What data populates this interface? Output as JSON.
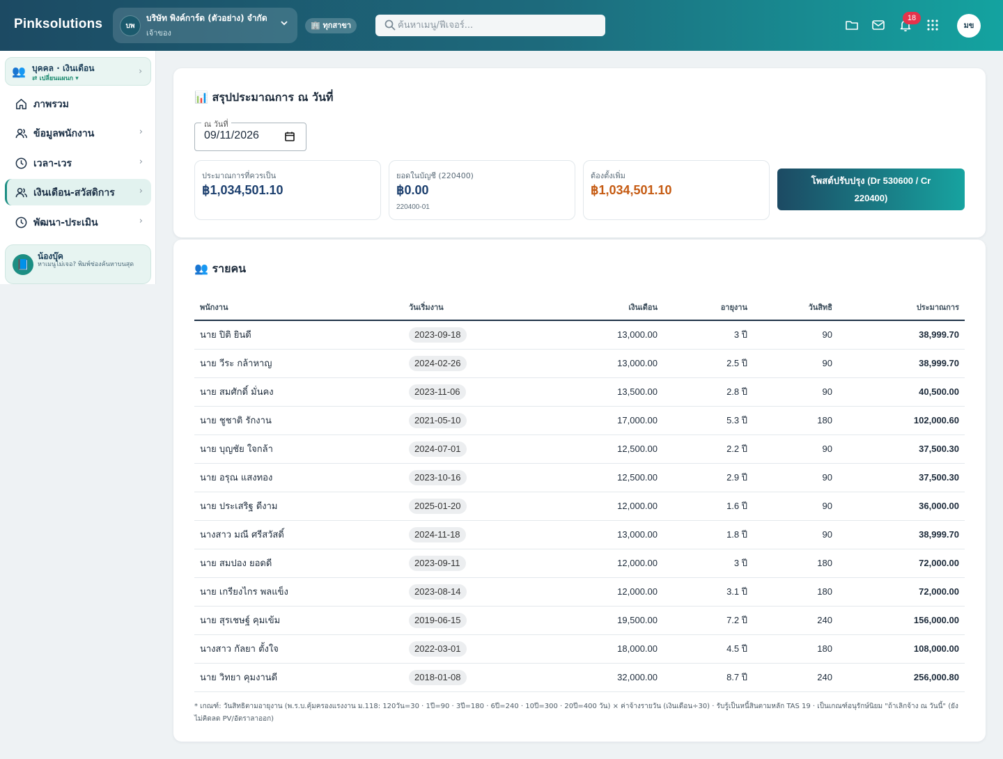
{
  "app": {
    "brand": "Pinksolutions"
  },
  "company": {
    "initials": "บพ",
    "name": "บริษัท พิงค์การ์ด (ตัวอย่าง) จำกัด",
    "role": "เจ้าของ"
  },
  "branch": {
    "label": "🏢 ทุกสาขา"
  },
  "search": {
    "placeholder": "ค้นหาเมนู/ฟีเจอร์..."
  },
  "notifications": {
    "count": "18"
  },
  "user": {
    "initials": "มข"
  },
  "sidebar": {
    "module": {
      "title": "บุคคล · เงินเดือน",
      "sub": "⇄ เปลี่ยนแผนก ▾"
    },
    "items": [
      {
        "label": "ภาพรวม"
      },
      {
        "label": "ข้อมูลพนักงาน"
      },
      {
        "label": "เวลา-เวร"
      },
      {
        "label": "เงินเดือน-สวัสดิการ"
      },
      {
        "label": "พัฒนา-ประเมิน"
      }
    ],
    "helper": {
      "name": "น้องบุ๊ค",
      "text": "หาเมนูไม่เจอ? พิมพ์ช่องค้นหาบนสุด"
    }
  },
  "summary": {
    "title": "📊 สรุปประมาณการ ณ วันที่",
    "date_label": "ณ วันที่",
    "date_value": "09/11/2026",
    "stats": [
      {
        "label": "ประมาณการที่ควรเป็น",
        "value": "฿1,034,501.10",
        "sub": ""
      },
      {
        "label": "ยอดในบัญชี (220400)",
        "value": "฿0.00",
        "sub": "220400-01"
      },
      {
        "label": "ต้องตั้งเพิ่ม",
        "value": "฿1,034,501.10",
        "sub": ""
      }
    ],
    "post_button": "โพสต์ปรับปรุง (Dr 530600 / Cr 220400)"
  },
  "employees": {
    "title": "👥 รายคน",
    "columns": [
      "พนักงาน",
      "วันเริ่มงาน",
      "เงินเดือน",
      "อายุงาน",
      "วันสิทธิ",
      "ประมาณการ"
    ],
    "rows": [
      [
        "นาย ปิติ ยินดี",
        "2023-09-18",
        "13,000.00",
        "3 ปี",
        "90",
        "38,999.70"
      ],
      [
        "นาย วีระ กล้าหาญ",
        "2024-02-26",
        "13,000.00",
        "2.5 ปี",
        "90",
        "38,999.70"
      ],
      [
        "นาย สมศักดิ์ มั่นคง",
        "2023-11-06",
        "13,500.00",
        "2.8 ปี",
        "90",
        "40,500.00"
      ],
      [
        "นาย ชูชาติ รักงาน",
        "2021-05-10",
        "17,000.00",
        "5.3 ปี",
        "180",
        "102,000.60"
      ],
      [
        "นาย บุญชัย ใจกล้า",
        "2024-07-01",
        "12,500.00",
        "2.2 ปี",
        "90",
        "37,500.30"
      ],
      [
        "นาย อรุณ แสงทอง",
        "2023-10-16",
        "12,500.00",
        "2.9 ปี",
        "90",
        "37,500.30"
      ],
      [
        "นาย ประเสริฐ ดีงาม",
        "2025-01-20",
        "12,000.00",
        "1.6 ปี",
        "90",
        "36,000.00"
      ],
      [
        "นางสาว มณี ศรีสวัสดิ์",
        "2024-11-18",
        "13,000.00",
        "1.8 ปี",
        "90",
        "38,999.70"
      ],
      [
        "นาย สมปอง ยอดดี",
        "2023-09-11",
        "12,000.00",
        "3 ปี",
        "180",
        "72,000.00"
      ],
      [
        "นาย เกรียงไกร พลแข็ง",
        "2023-08-14",
        "12,000.00",
        "3.1 ปี",
        "180",
        "72,000.00"
      ],
      [
        "นาย สุรเชษฐ์ คุมเข้ม",
        "2019-06-15",
        "19,500.00",
        "7.2 ปี",
        "240",
        "156,000.00"
      ],
      [
        "นางสาว กัลยา ตั้งใจ",
        "2022-03-01",
        "18,000.00",
        "4.5 ปี",
        "180",
        "108,000.00"
      ],
      [
        "นาย วิทยา คุมงานดี",
        "2018-01-08",
        "32,000.00",
        "8.7 ปี",
        "240",
        "256,000.80"
      ]
    ],
    "footnote": "* เกณฑ์: วันสิทธิตามอายุงาน (พ.ร.บ.คุ้มครองแรงงาน ม.118: 120วัน=30 · 1ปี=90 · 3ปี=180 · 6ปี=240 · 10ปี=300 · 20ปี=400 วัน) × ค่าจ้างรายวัน (เงินเดือน÷30) · รับรู้เป็นหนี้สินตามหลัก TAS 19 · เป็นเกณฑ์อนุรักษ์นิยม \"ถ้าเลิกจ้าง ณ วันนี้\" (ยังไม่คิดลด PV/อัตราลาออก)"
  }
}
